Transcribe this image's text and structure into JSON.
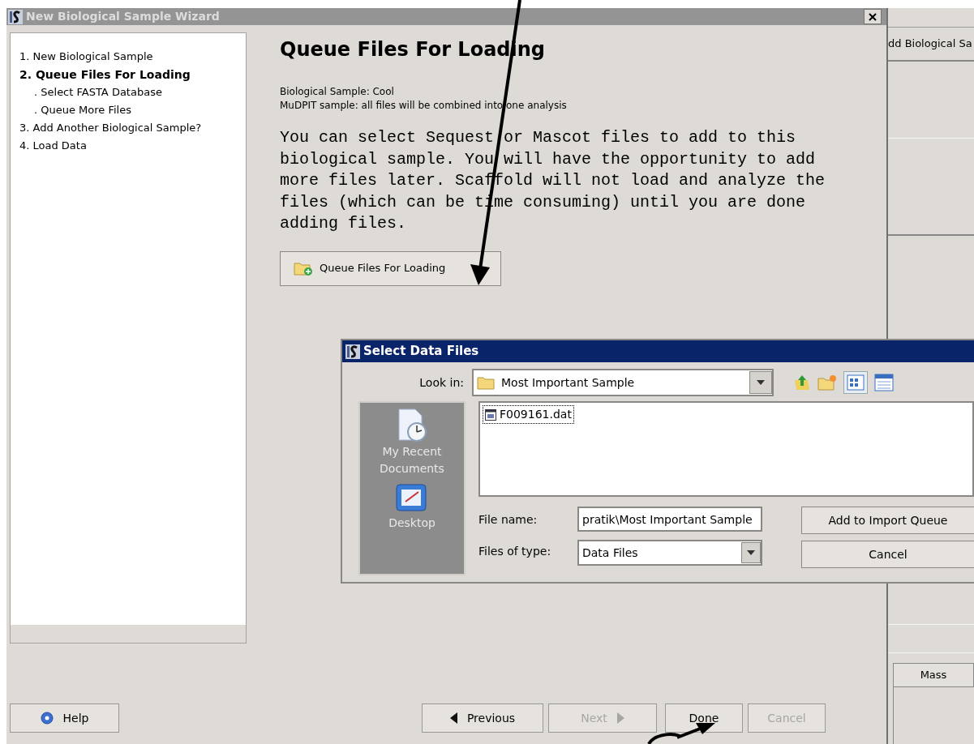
{
  "wizard": {
    "title": "New Biological Sample Wizard",
    "steps": [
      {
        "label": "1. New Biological Sample",
        "selected": false
      },
      {
        "label": "2. Queue Files For Loading",
        "selected": true,
        "children": [
          {
            "label": ". Select FASTA Database",
            "selected": false
          },
          {
            "label": ". Queue More Files",
            "selected": false
          }
        ]
      },
      {
        "label": "3. Add Another Biological Sample?",
        "selected": false
      },
      {
        "label": "4. Load Data",
        "selected": false
      }
    ],
    "heading": "Queue Files For Loading",
    "sample_info": [
      "Biological Sample: Cool",
      "MuDPIT sample: all files will be combined into one analysis"
    ],
    "description": "You can select Sequest or Mascot files to add to this biological sample. You will have the opportunity to add more files later. Scaffold will not load and analyze the files (which can be time consuming) until you are done adding files.",
    "queue_button": "Queue Files For Loading",
    "footer_buttons": [
      {
        "kind": "help",
        "label": "Help",
        "disabled": false
      },
      {
        "kind": "previous",
        "label": "Previous",
        "disabled": false
      },
      {
        "kind": "next",
        "label": "Next",
        "disabled": true
      },
      {
        "kind": "plain",
        "label": "Done",
        "disabled": false
      },
      {
        "kind": "plain",
        "label": "Cancel",
        "disabled": true
      }
    ]
  },
  "dialog": {
    "title": "Select Data Files",
    "look_in_label": "Look in:",
    "look_in_value": "Most Important Sample",
    "places": [
      {
        "kind": "recent",
        "label": "My Recent Documents"
      },
      {
        "kind": "desktop",
        "label": "Desktop"
      }
    ],
    "files": [
      {
        "name": "F009161.dat",
        "selected": true
      }
    ],
    "file_name_label": "File name:",
    "file_name_value": "pratik\\Most Important Sample",
    "file_type_label": "Files of type:",
    "file_type_value": "Data Files",
    "buttons": [
      "Add to Import Queue",
      "Cancel"
    ]
  },
  "background_window": {
    "button_label": "dd Biological Sa",
    "column_header": "Mass"
  }
}
